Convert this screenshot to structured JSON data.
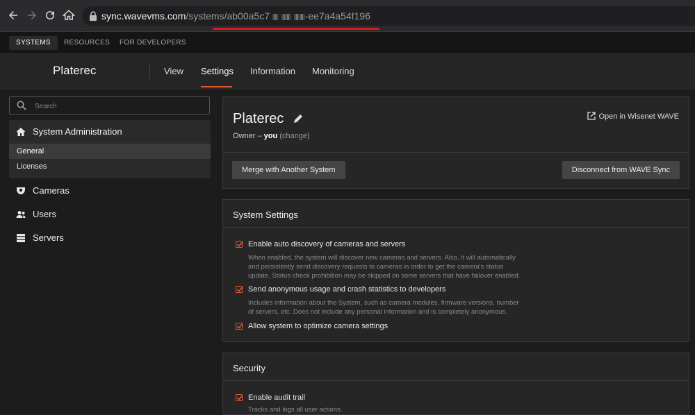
{
  "browser": {
    "url_host": "sync.wavevms.com",
    "url_path_start": "/systems/ab00a5c7",
    "url_path_end": "-ee7a4a54f196"
  },
  "top_tabs": [
    "SYSTEMS",
    "RESOURCES",
    "FOR DEVELOPERS"
  ],
  "header": {
    "system_name": "Platerec",
    "nav": [
      "View",
      "Settings",
      "Information",
      "Monitoring"
    ]
  },
  "sidebar": {
    "search_placeholder": "Search",
    "section_title": "System Administration",
    "subitems": [
      "General",
      "Licenses"
    ],
    "items": [
      "Cameras",
      "Users",
      "Servers"
    ]
  },
  "system_panel": {
    "title": "Platerec",
    "owner_prefix": "Owner – ",
    "owner_name": "you",
    "owner_change": "(change)",
    "open_link": "Open in Wisenet WAVE",
    "merge_button": "Merge with Another System",
    "disconnect_button": "Disconnect from WAVE Sync"
  },
  "system_settings": {
    "title": "System Settings",
    "options": [
      {
        "label": "Enable auto discovery of cameras and servers",
        "desc_lines": [
          "When enabled, the system will discover new cameras and servers. Also, it will automatically",
          "and persistently send discovery requests to cameras in order to get the camera's status",
          "update. Status check prohibition may be skipped on some servers that have failover enabled."
        ]
      },
      {
        "label": "Send anonymous usage and crash statistics to developers",
        "desc_lines": [
          "Includes information about the System, such as camera modules, firmware versions, number",
          "of servers, etc. Does not include any personal information and is completely anonymous."
        ]
      },
      {
        "label": "Allow system to optimize camera settings",
        "desc_lines": []
      }
    ]
  },
  "security": {
    "title": "Security",
    "option_label": "Enable audit trail",
    "option_desc": "Tracks and logs all user actions."
  },
  "colors": {
    "accent": "#e4592e",
    "annotation_red": "#d8191c"
  }
}
